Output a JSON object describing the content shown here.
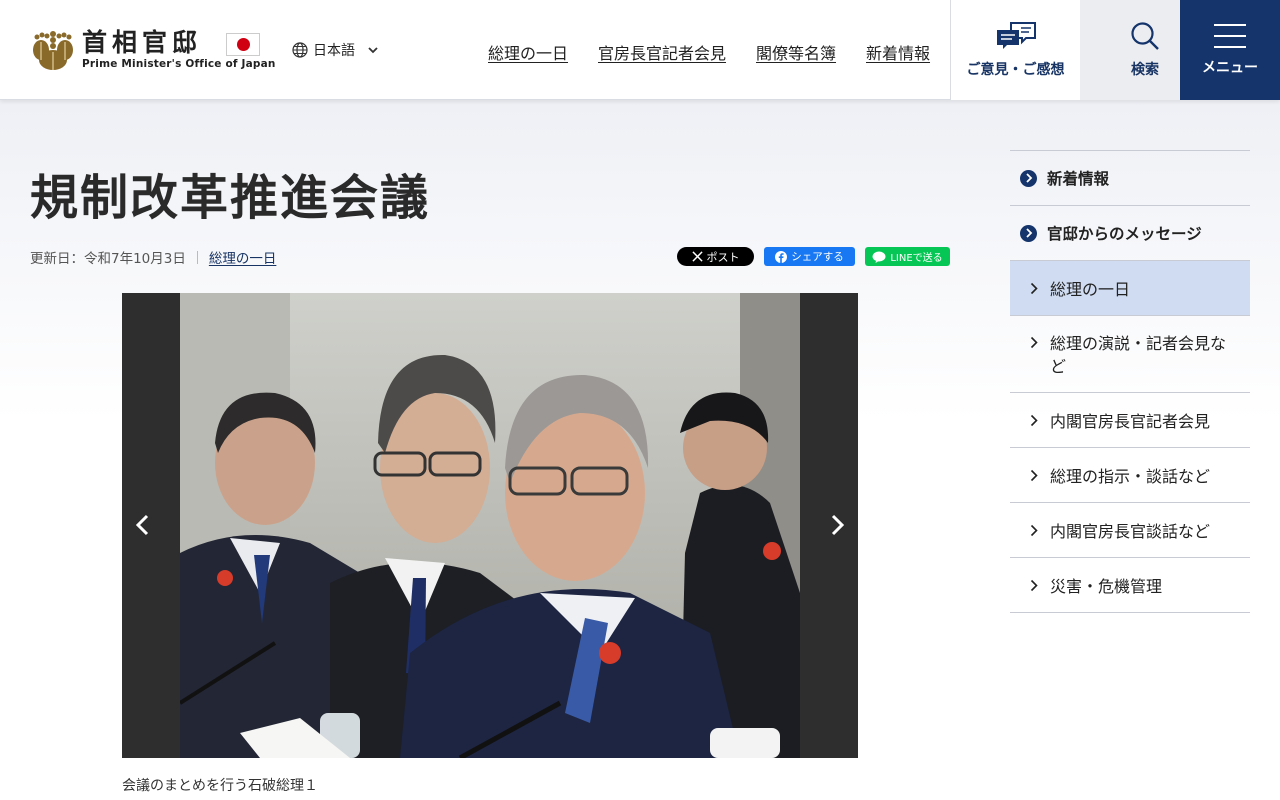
{
  "header": {
    "logo_title": "首相官邸",
    "logo_subtitle": "Prime Minister's Office of Japan",
    "language": "日本語",
    "nav": [
      {
        "label": "総理の一日"
      },
      {
        "label": "官房長官記者会見"
      },
      {
        "label": "閣僚等名簿"
      },
      {
        "label": "新着情報"
      }
    ],
    "opinion_label": "ご意見・ご感想",
    "search_label": "検索",
    "menu_label": "メニュー"
  },
  "main": {
    "title": "規制改革推進会議",
    "updated": "更新日：令和7年10月3日",
    "category_link": "総理の一日",
    "share": {
      "x": "ポスト",
      "facebook": "シェアする",
      "line": "LINEで送る"
    },
    "caption": "会議のまとめを行う石破総理１"
  },
  "sidebar": {
    "main_items": [
      {
        "label": "新着情報"
      },
      {
        "label": "官邸からのメッセージ"
      }
    ],
    "sub_items": [
      {
        "label": "総理の一日"
      },
      {
        "label": "総理の演説・記者会見など"
      },
      {
        "label": "内閣官房長官記者会見"
      },
      {
        "label": "総理の指示・談話など"
      },
      {
        "label": "内閣官房長官談話など"
      },
      {
        "label": "災害・危機管理"
      }
    ]
  },
  "colors": {
    "navy": "#14346b",
    "active_bg": "#cfdcf1",
    "flag_red": "#d00012",
    "facebook": "#1877f2",
    "line": "#06c755"
  }
}
